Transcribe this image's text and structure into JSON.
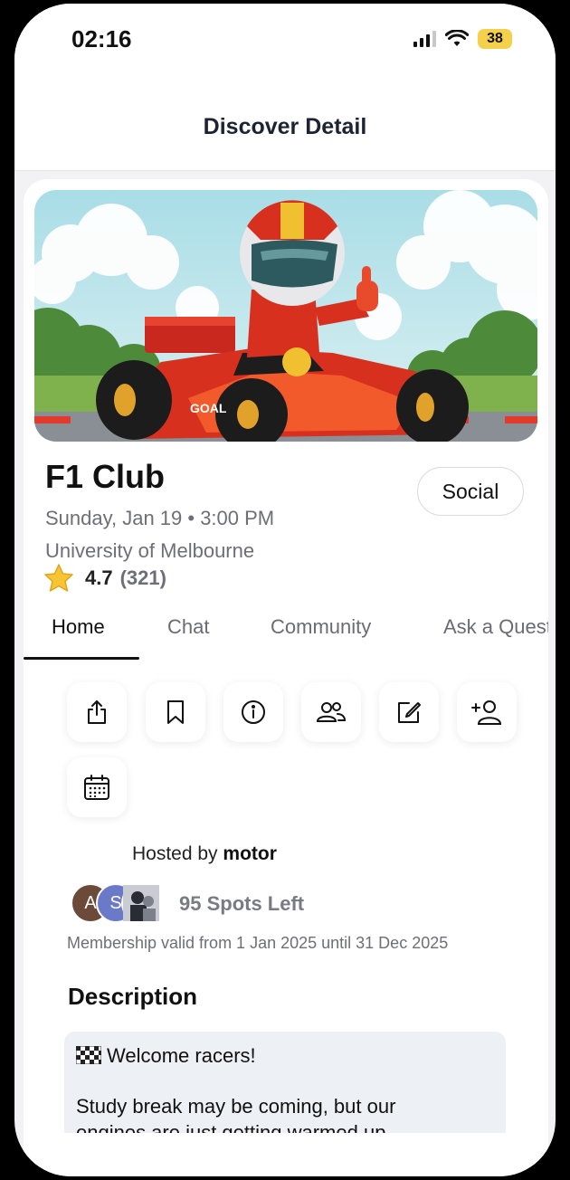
{
  "status": {
    "time": "02:16",
    "battery": "38"
  },
  "nav": {
    "title": "Discover Detail"
  },
  "club": {
    "name": "F1 Club",
    "category": "Social",
    "date": "Sunday, Jan 19 • 3:00 PM",
    "location": "University of Melbourne",
    "rating": "4.7",
    "rating_count": "(321)"
  },
  "tabs": [
    "Home",
    "Chat",
    "Community",
    "Ask a Question"
  ],
  "actions": [
    "share-icon",
    "bookmark-icon",
    "info-icon",
    "members-icon",
    "edit-icon",
    "add-person-icon",
    "calendar-icon"
  ],
  "host": {
    "prefix": "Hosted by",
    "name": "motor"
  },
  "avatars": [
    "A",
    "S"
  ],
  "spots_left": "95 Spots Left",
  "membership": "Membership valid from 1 Jan 2025 until 31 Dec 2025",
  "description": {
    "heading": "Description",
    "line1": "Welcome racers!",
    "line2": "Study break may be coming, but our",
    "line3": "engines are just getting warmed up"
  },
  "colors": {
    "accent": "#111111",
    "muted": "#6e6e78",
    "desc_bg": "#edf0f4",
    "battery": "#f5d14b"
  }
}
